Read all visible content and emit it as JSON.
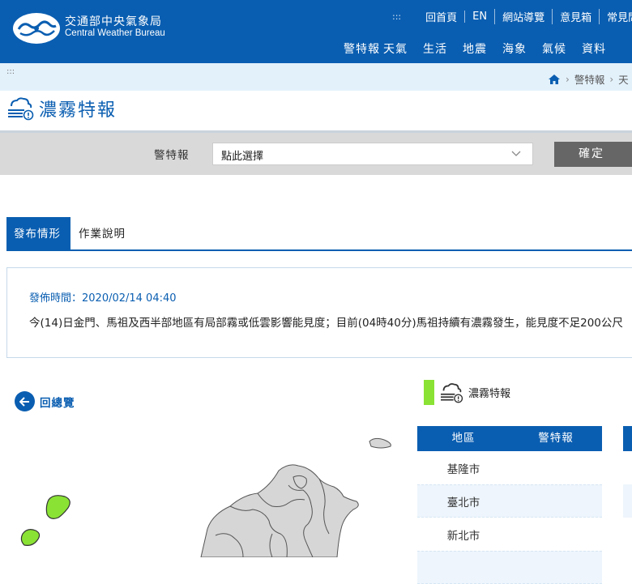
{
  "header": {
    "logo_zh": "交通部中央氣象局",
    "logo_en": "Central Weather Bureau",
    "toplinks_dots": ":::",
    "toplinks": [
      "回首頁",
      "EN",
      "網站導覽",
      "意見箱",
      "常見問答"
    ],
    "nav": [
      "警特報",
      "天氣",
      "生活",
      "地震",
      "海象",
      "氣候",
      "資料"
    ]
  },
  "breadcrumb": {
    "dots": ":::",
    "items": [
      "警特報",
      "天"
    ]
  },
  "page_title": "濃霧特報",
  "filter": {
    "label": "警特報",
    "select_value": "點此選擇",
    "confirm_label": "確定"
  },
  "tabs": [
    {
      "label": "發布情形",
      "active": true
    },
    {
      "label": "作業說明",
      "active": false
    }
  ],
  "notice": {
    "time": "發佈時間：2020/02/14 04:40",
    "message": "今(14)日金門、馬祖及西半部地區有局部霧或低雲影響能見度；目前(04時40分)馬祖持續有濃霧發生，能見度不足200公尺"
  },
  "back_label": "回總覽",
  "legend": {
    "label": "濃霧特報",
    "color": "#8ae234"
  },
  "table": {
    "headers": [
      "地區",
      "警特報"
    ],
    "rows": [
      {
        "region": "基隆市",
        "alert": ""
      },
      {
        "region": "臺北市",
        "alert": ""
      },
      {
        "region": "新北市",
        "alert": ""
      }
    ]
  },
  "colors": {
    "brand": "#0a5eb1",
    "alert_green": "#8ae234",
    "map_gray": "#d6d6d6"
  }
}
